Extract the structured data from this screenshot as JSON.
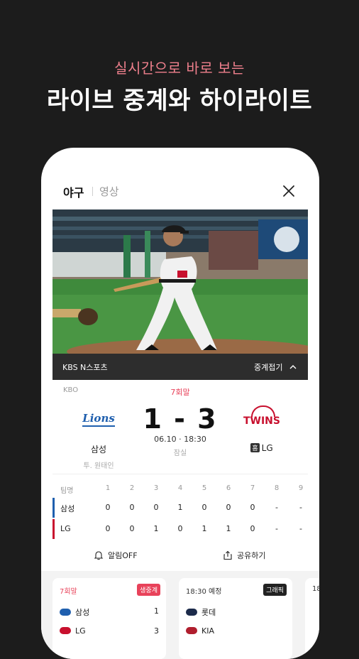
{
  "promo": {
    "subtitle": "실시간으로 바로 보는",
    "title": "라이브 중계와 하이라이트"
  },
  "header": {
    "tab_baseball": "야구",
    "tab_video": "영상"
  },
  "video_bar": {
    "broadcaster": "KBS N스포츠",
    "collapse_label": "중계접기"
  },
  "game": {
    "league": "KBO",
    "inning": "7회말",
    "home_name": "삼성",
    "home_pitcher": "투. 원태인",
    "away_name": "LG",
    "away_home_badge": "홈",
    "score": "1 - 3",
    "datetime": "06.10 · 18:30",
    "stadium": "잠실",
    "home_logo_text": "Lions",
    "away_logo_text": "TWINS"
  },
  "linescore": {
    "header_label": "팀명",
    "innings": [
      "1",
      "2",
      "3",
      "4",
      "5",
      "6",
      "7",
      "8",
      "9"
    ],
    "rows": [
      {
        "team": "삼성",
        "scores": [
          "0",
          "0",
          "0",
          "1",
          "0",
          "0",
          "0",
          "-",
          "-"
        ]
      },
      {
        "team": "LG",
        "scores": [
          "0",
          "0",
          "1",
          "0",
          "1",
          "1",
          "0",
          "-",
          "-"
        ]
      }
    ]
  },
  "actions": {
    "notify_label": "알림OFF",
    "share_label": "공유하기"
  },
  "cards": [
    {
      "status": "7회말",
      "badge": "생중계",
      "team1": "삼성",
      "score1": "1",
      "team2": "LG",
      "score2": "3"
    },
    {
      "status": "18:30 예정",
      "badge": "그래픽",
      "team1": "롯데",
      "score1": "",
      "team2": "KIA",
      "score2": ""
    },
    {
      "status": "18"
    }
  ],
  "colors": {
    "accent_pink": "#ee7f8c",
    "live_red": "#e8425a",
    "samsung_blue": "#1f5fae",
    "lg_red": "#c8102e",
    "dark_bg": "#1c1c1c"
  }
}
